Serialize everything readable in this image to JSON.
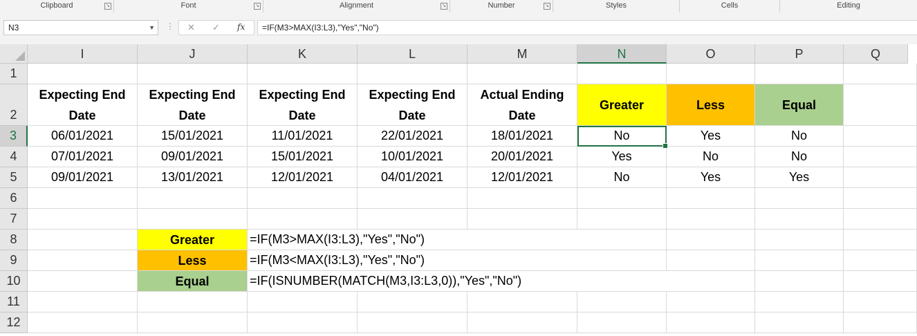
{
  "ribbon": {
    "groups": [
      {
        "label": "Clipboard",
        "launcher": true
      },
      {
        "label": "Font",
        "launcher": true
      },
      {
        "label": "Alignment",
        "launcher": true
      },
      {
        "label": "Number",
        "launcher": true
      },
      {
        "label": "Styles",
        "launcher": false
      },
      {
        "label": "Cells",
        "launcher": false
      },
      {
        "label": "Editing",
        "launcher": false
      }
    ]
  },
  "formula_bar": {
    "name_box": "N3",
    "cancel_icon": "✕",
    "enter_icon": "✓",
    "fx_label": "fx",
    "formula": "=IF(M3>MAX(I3:L3),\"Yes\",\"No\")"
  },
  "columns": [
    "I",
    "J",
    "K",
    "L",
    "M",
    "N",
    "O",
    "P",
    "Q"
  ],
  "selected_column": "N",
  "rows": [
    "1",
    "2",
    "3",
    "4",
    "5",
    "6",
    "7",
    "8",
    "9",
    "10",
    "11",
    "12"
  ],
  "selected_row": "3",
  "headers": {
    "I": "Expecting End Date",
    "J": "Expecting End Date",
    "K": "Expecting End Date",
    "L": "Expecting End Date",
    "M": "Actual Ending Date",
    "N": "Greater",
    "O": "Less",
    "P": "Equal"
  },
  "data_rows": [
    {
      "I": "06/01/2021",
      "J": "15/01/2021",
      "K": "11/01/2021",
      "L": "22/01/2021",
      "M": "18/01/2021",
      "N": "No",
      "O": "Yes",
      "P": "No"
    },
    {
      "I": "07/01/2021",
      "J": "09/01/2021",
      "K": "15/01/2021",
      "L": "10/01/2021",
      "M": "20/01/2021",
      "N": "Yes",
      "O": "No",
      "P": "No"
    },
    {
      "I": "09/01/2021",
      "J": "13/01/2021",
      "K": "12/01/2021",
      "L": "04/01/2021",
      "M": "12/01/2021",
      "N": "No",
      "O": "Yes",
      "P": "Yes"
    }
  ],
  "legend": [
    {
      "label": "Greater",
      "formula": "=IF(M3>MAX(I3:L3),\"Yes\",\"No\")"
    },
    {
      "label": "Less",
      "formula": "=IF(M3<MAX(I3:L3),\"Yes\",\"No\")"
    },
    {
      "label": "Equal",
      "formula": "=IF(ISNUMBER(MATCH(M3,I3:L3,0)),\"Yes\",\"No\")"
    }
  ],
  "colors": {
    "greater": "#ffff00",
    "less": "#ffc000",
    "equal": "#a9d08e",
    "selection": "#217346"
  }
}
